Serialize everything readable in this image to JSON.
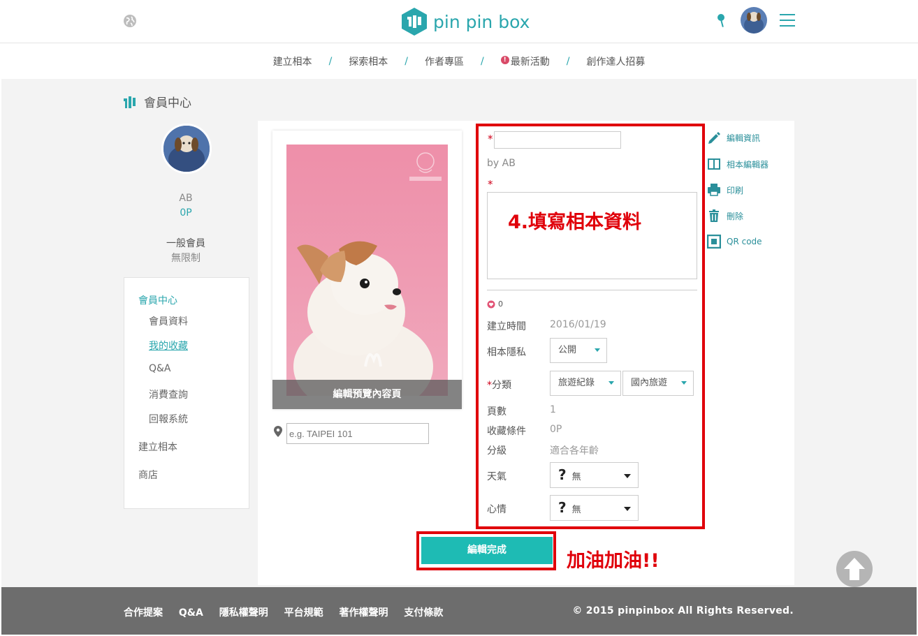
{
  "header": {
    "brand": "pin pin box",
    "icons": [
      "globe-icon",
      "pin-icon",
      "avatar",
      "hamburger-icon"
    ],
    "accent_color": "#2aa6ad"
  },
  "nav": {
    "items": [
      "建立相本",
      "探索相本",
      "作者專區",
      "最新活動",
      "創作達人招募"
    ],
    "separator": "/",
    "alert_badge": "!"
  },
  "member": {
    "section_title": "會員中心",
    "name": "AB",
    "points": "0P",
    "level": "一般會員",
    "limit": "無限制"
  },
  "sidebar": {
    "head": "會員中心",
    "items": [
      "會員資料",
      "我的收藏",
      "Q&A",
      "消費查詢",
      "回報系統"
    ],
    "create": "建立相本",
    "shop": "商店"
  },
  "preview": {
    "overlay_label": "編輯預覽內容頁",
    "location_placeholder": "e.g. TAIPEI 101"
  },
  "form": {
    "required_mark": "*",
    "byline": "by AB",
    "annotation": "4.填寫相本資料",
    "likes": "0",
    "created_label": "建立時間",
    "created_value": "2016/01/19",
    "privacy_label": "相本隱私",
    "privacy_value": "公開",
    "category_label": "分類",
    "category_value": "旅遊紀錄",
    "subcategory_value": "國內旅遊",
    "pages_label": "頁數",
    "pages_value": "1",
    "collect_label": "收藏條件",
    "collect_value": "0P",
    "rating_label": "分級",
    "rating_value": "適合各年齡",
    "weather_label": "天氣",
    "weather_value": "無",
    "mood_label": "心情",
    "mood_value": "無",
    "question_glyph": "?"
  },
  "actions": {
    "edit_info": "編輯資訊",
    "album_editor": "相本編輯器",
    "print": "印刷",
    "delete": "刪除",
    "qr": "QR code"
  },
  "submit": {
    "label": "編輯完成",
    "cheer": "加油加油!!"
  },
  "footer": {
    "links": [
      "合作提案",
      "Q&A",
      "隱私權聲明",
      "平台規範",
      "著作權聲明",
      "支付條款"
    ],
    "copyright": "© 2015 pinpinbox All Rights Reserved."
  }
}
